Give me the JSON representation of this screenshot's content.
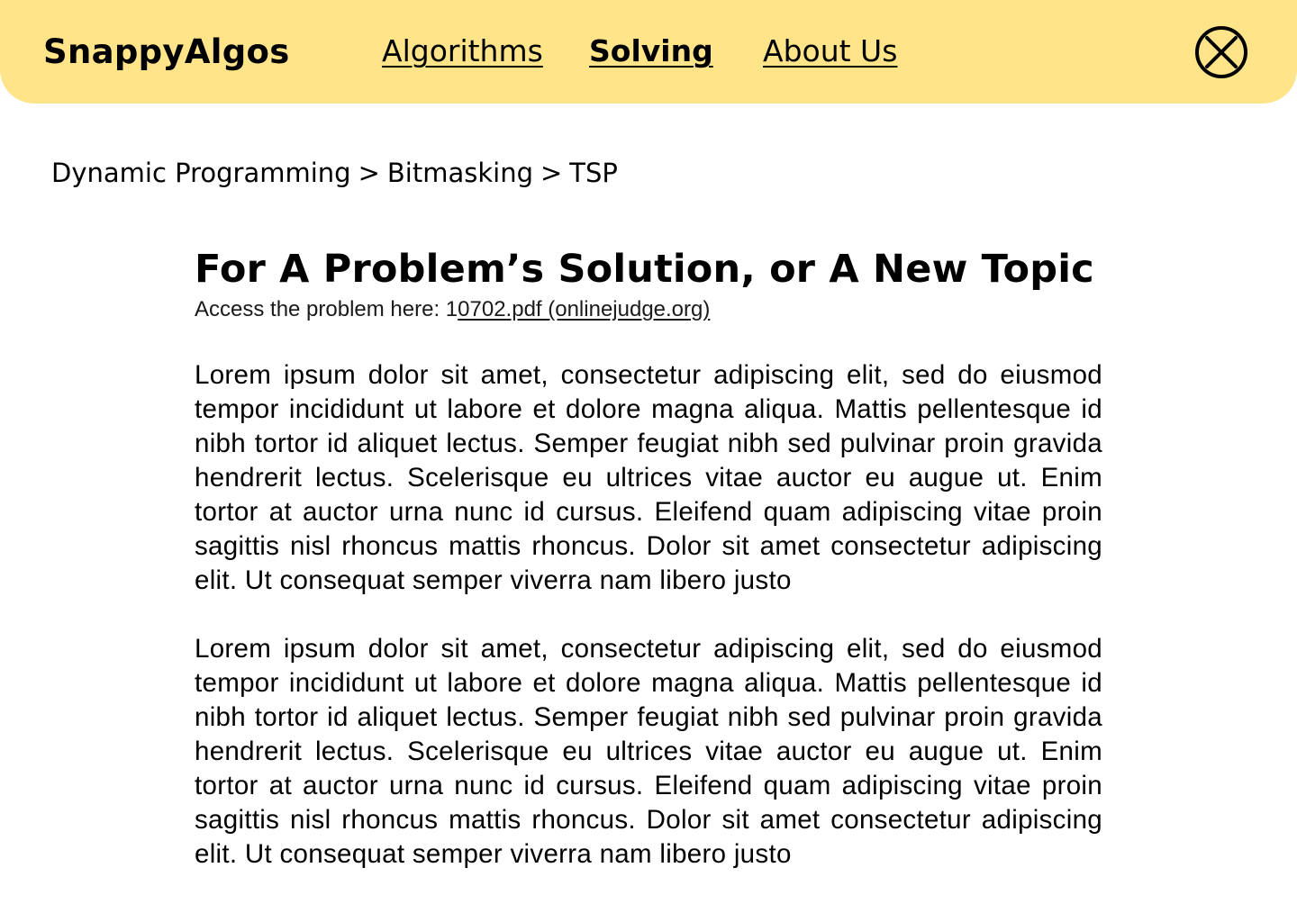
{
  "colors": {
    "header_bg": "#FFE48A",
    "text": "#000000",
    "page_bg": "#FFFFFF"
  },
  "header": {
    "brand": "SnappyAlgos",
    "nav": {
      "algorithms": "Algorithms",
      "solving": "Solving",
      "about": "About Us"
    },
    "close_icon": "circle-x-icon"
  },
  "breadcrumb": {
    "items": [
      "Dynamic Programming",
      "Bitmasking",
      "TSP"
    ],
    "separator": ">"
  },
  "main": {
    "title": "For A Problem’s Solution, or A New Topic",
    "access_prefix": "Access the problem here: 1",
    "access_link": "0702.pdf (onlinejudge.org)",
    "paragraphs": [
      "Lorem ipsum dolor sit amet, consectetur adipiscing elit, sed do eiusmod tempor incididunt ut labore et dolore magna aliqua. Mattis pellentesque id nibh tortor id aliquet lectus. Semper feugiat nibh sed pulvinar proin gravida hendrerit lectus. Scelerisque eu ultrices vitae auctor eu augue ut. Enim tortor at auctor urna nunc id cursus. Eleifend quam adipiscing vitae proin sagittis nisl rhoncus mattis rhoncus. Dolor sit amet consectetur adipiscing elit. Ut consequat semper viverra nam libero justo",
      "Lorem ipsum dolor sit amet, consectetur adipiscing elit, sed do eiusmod tempor incididunt ut labore et dolore magna aliqua. Mattis pellentesque id nibh tortor id aliquet lectus. Semper feugiat nibh sed pulvinar proin gravida hendrerit lectus. Scelerisque eu ultrices vitae auctor eu augue ut. Enim tortor at auctor urna nunc id cursus. Eleifend quam adipiscing vitae proin sagittis nisl rhoncus mattis rhoncus. Dolor sit amet consectetur adipiscing elit. Ut consequat semper viverra nam libero justo"
    ]
  }
}
